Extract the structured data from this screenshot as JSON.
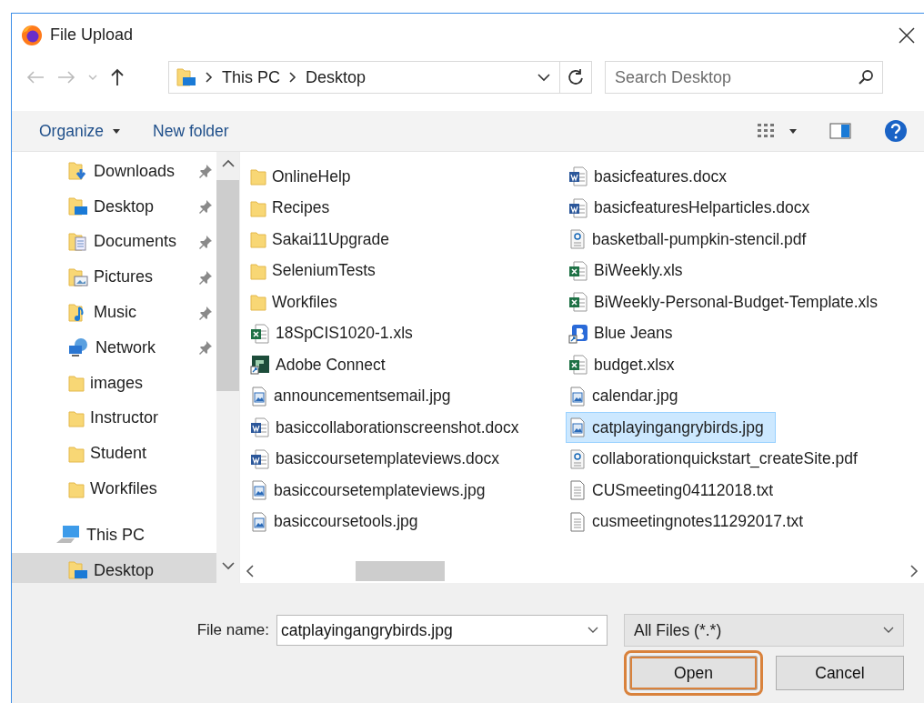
{
  "window": {
    "title": "File Upload"
  },
  "address_bar": {
    "path": [
      "This PC",
      "Desktop"
    ]
  },
  "search": {
    "placeholder": "Search Desktop"
  },
  "toolbar": {
    "buttons": [
      {
        "label": "Organize",
        "dropdown": true
      },
      {
        "label": "New folder",
        "dropdown": false
      }
    ]
  },
  "sidebar": {
    "items": [
      {
        "label": "Downloads",
        "kind": "downloads",
        "pinned": true,
        "selected": false
      },
      {
        "label": "Desktop",
        "kind": "desktop",
        "pinned": true,
        "selected": false
      },
      {
        "label": "Documents",
        "kind": "documents",
        "pinned": true,
        "selected": false
      },
      {
        "label": "Pictures",
        "kind": "pictures",
        "pinned": true,
        "selected": false
      },
      {
        "label": "Music",
        "kind": "music",
        "pinned": true,
        "selected": false
      },
      {
        "label": "Network",
        "kind": "network",
        "pinned": true,
        "selected": false
      },
      {
        "label": "images",
        "kind": "folder",
        "pinned": false,
        "selected": false
      },
      {
        "label": "Instructor",
        "kind": "folder",
        "pinned": false,
        "selected": false
      },
      {
        "label": "Student",
        "kind": "folder",
        "pinned": false,
        "selected": false
      },
      {
        "label": "Workfiles",
        "kind": "folder",
        "pinned": false,
        "selected": false
      },
      {
        "label": "This PC",
        "kind": "pc",
        "pinned": false,
        "selected": false,
        "children": [
          {
            "label": "Desktop",
            "kind": "desktop",
            "pinned": false,
            "selected": true
          }
        ]
      }
    ]
  },
  "files": [
    {
      "name": "OnlineHelp",
      "kind": "folder",
      "selected": false
    },
    {
      "name": "Recipes",
      "kind": "folder",
      "selected": false
    },
    {
      "name": "Sakai11Upgrade",
      "kind": "folder",
      "selected": false
    },
    {
      "name": "SeleniumTests",
      "kind": "folder",
      "selected": false
    },
    {
      "name": "Workfiles",
      "kind": "folder",
      "selected": false
    },
    {
      "name": "18SpCIS1020-1.xls",
      "kind": "excel",
      "selected": false
    },
    {
      "name": "Adobe Connect",
      "kind": "shortcut",
      "selected": false
    },
    {
      "name": "announcementsemail.jpg",
      "kind": "image",
      "selected": false
    },
    {
      "name": "basiccollaborationscreenshot.docx",
      "kind": "word",
      "selected": false
    },
    {
      "name": "basiccoursetemplateviews.docx",
      "kind": "word",
      "selected": false
    },
    {
      "name": "basiccoursetemplateviews.jpg",
      "kind": "image",
      "selected": false
    },
    {
      "name": "basiccoursetools.jpg",
      "kind": "image",
      "selected": false
    },
    {
      "name": "basicfeatures.docx",
      "kind": "word",
      "selected": false
    },
    {
      "name": "basicfeaturesHelparticles.docx",
      "kind": "word",
      "selected": false
    },
    {
      "name": "basketball-pumpkin-stencil.pdf",
      "kind": "pdf",
      "selected": false
    },
    {
      "name": "BiWeekly.xls",
      "kind": "excel",
      "selected": false
    },
    {
      "name": "BiWeekly-Personal-Budget-Template.xls",
      "kind": "excel",
      "selected": false
    },
    {
      "name": "Blue Jeans",
      "kind": "app",
      "selected": false
    },
    {
      "name": "budget.xlsx",
      "kind": "excel",
      "selected": false
    },
    {
      "name": "calendar.jpg",
      "kind": "image",
      "selected": false
    },
    {
      "name": "catplayingangrybirds.jpg",
      "kind": "image",
      "selected": true
    },
    {
      "name": "collaborationquickstart_createSite.pdf",
      "kind": "pdf",
      "selected": false
    },
    {
      "name": "CUSmeeting04112018.txt",
      "kind": "text",
      "selected": false
    },
    {
      "name": "cusmeetingnotes11292017.txt",
      "kind": "text",
      "selected": false
    }
  ],
  "file_name": {
    "label": "File name:",
    "value": "catplayingangrybirds.jpg"
  },
  "file_type": {
    "value": "All Files (*.*)"
  },
  "buttons": [
    {
      "label": "Open",
      "highlighted": true
    },
    {
      "label": "Cancel",
      "highlighted": false
    }
  ]
}
